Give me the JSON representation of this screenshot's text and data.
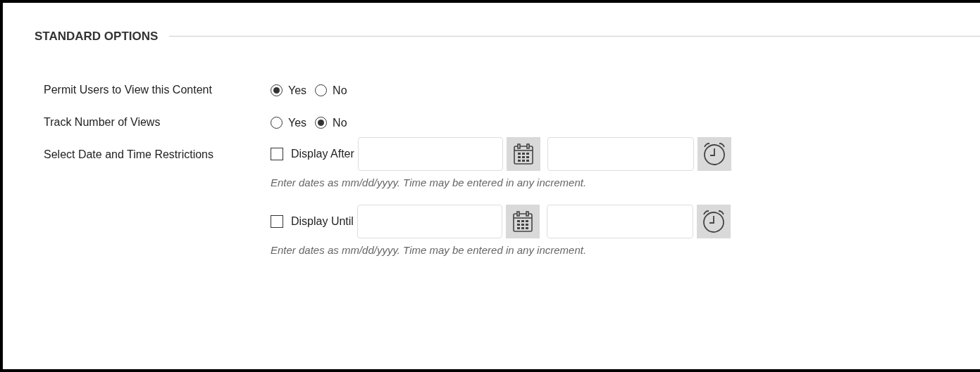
{
  "section": {
    "title": "STANDARD OPTIONS"
  },
  "options": [
    {
      "kind": "radio",
      "label": "Permit Users to View this Content",
      "choices": [
        {
          "label": "Yes",
          "selected": true
        },
        {
          "label": "No",
          "selected": false
        }
      ]
    },
    {
      "kind": "radio",
      "label": "Track Number of Views",
      "choices": [
        {
          "label": "Yes",
          "selected": false
        },
        {
          "label": "No",
          "selected": true
        }
      ]
    },
    {
      "kind": "dates",
      "label": "Select Date and Time Restrictions",
      "restrictions": [
        {
          "label": "Display After",
          "checked": false,
          "hint": "Enter dates as mm/dd/yyyy. Time may be entered in any increment."
        },
        {
          "label": "Display Until",
          "checked": false,
          "hint": "Enter dates as mm/dd/yyyy. Time may be entered in any increment."
        }
      ]
    }
  ]
}
